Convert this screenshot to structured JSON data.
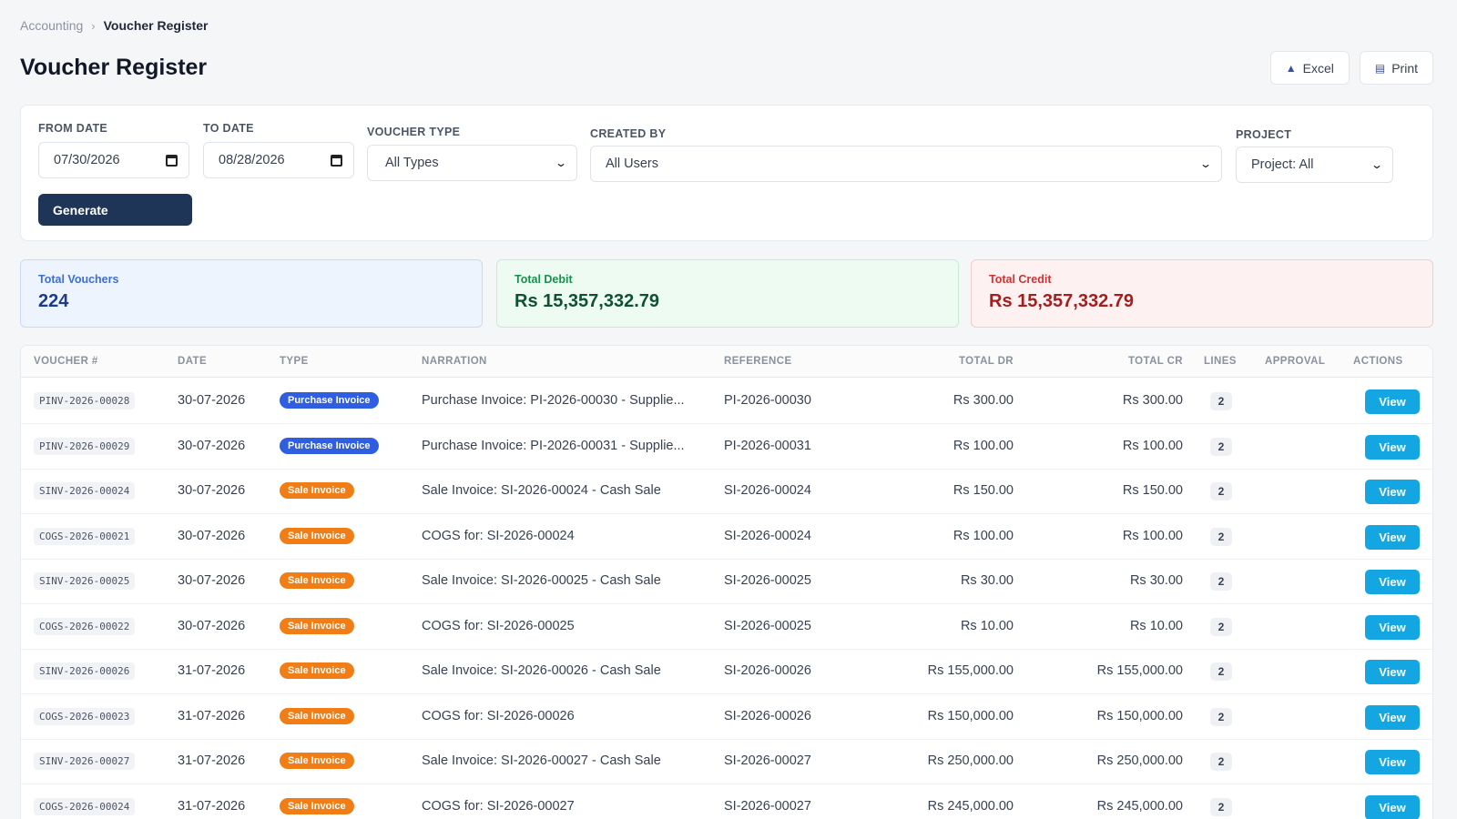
{
  "breadcrumb": {
    "parent": "Accounting",
    "separator": "›",
    "current": "Voucher Register"
  },
  "page_title": "Voucher Register",
  "actions": {
    "excel_label": "Excel",
    "print_label": "Print"
  },
  "filters": {
    "from_date_label": "FROM DATE",
    "from_date_value": "07/30/2026",
    "to_date_label": "TO DATE",
    "to_date_value": "08/28/2026",
    "voucher_type_label": "VOUCHER TYPE",
    "voucher_type_value": "All Types",
    "created_by_label": "CREATED BY",
    "created_by_value": "All Users",
    "project_label": "PROJECT",
    "project_value": "Project: All",
    "generate_label": "Generate"
  },
  "summary": {
    "total_vouchers_label": "Total Vouchers",
    "total_vouchers_value": "224",
    "total_debit_label": "Total Debit",
    "total_debit_value": "Rs 15,357,332.79",
    "total_credit_label": "Total Credit",
    "total_credit_value": "Rs 15,357,332.79"
  },
  "table": {
    "headers": [
      "VOUCHER #",
      "DATE",
      "TYPE",
      "NARRATION",
      "REFERENCE",
      "TOTAL DR",
      "TOTAL CR",
      "LINES",
      "APPROVAL",
      "ACTIONS"
    ],
    "rows": [
      {
        "voucher": "PINV-2026-00028",
        "date": "30-07-2026",
        "type": "Purchase Invoice",
        "narration": "Purchase Invoice: PI-2026-00030 - Supplie...",
        "reference": "PI-2026-00030",
        "dr": "Rs 300.00",
        "cr": "Rs 300.00",
        "lines": "2",
        "action": "View"
      },
      {
        "voucher": "PINV-2026-00029",
        "date": "30-07-2026",
        "type": "Purchase Invoice",
        "narration": "Purchase Invoice: PI-2026-00031 - Supplie...",
        "reference": "PI-2026-00031",
        "dr": "Rs 100.00",
        "cr": "Rs 100.00",
        "lines": "2",
        "action": "View"
      },
      {
        "voucher": "SINV-2026-00024",
        "date": "30-07-2026",
        "type": "Sale Invoice",
        "narration": "Sale Invoice: SI-2026-00024 - Cash Sale",
        "reference": "SI-2026-00024",
        "dr": "Rs 150.00",
        "cr": "Rs 150.00",
        "lines": "2",
        "action": "View"
      },
      {
        "voucher": "COGS-2026-00021",
        "date": "30-07-2026",
        "type": "Sale Invoice",
        "narration": "COGS for: SI-2026-00024",
        "reference": "SI-2026-00024",
        "dr": "Rs 100.00",
        "cr": "Rs 100.00",
        "lines": "2",
        "action": "View"
      },
      {
        "voucher": "SINV-2026-00025",
        "date": "30-07-2026",
        "type": "Sale Invoice",
        "narration": "Sale Invoice: SI-2026-00025 - Cash Sale",
        "reference": "SI-2026-00025",
        "dr": "Rs 30.00",
        "cr": "Rs 30.00",
        "lines": "2",
        "action": "View"
      },
      {
        "voucher": "COGS-2026-00022",
        "date": "30-07-2026",
        "type": "Sale Invoice",
        "narration": "COGS for: SI-2026-00025",
        "reference": "SI-2026-00025",
        "dr": "Rs 10.00",
        "cr": "Rs 10.00",
        "lines": "2",
        "action": "View"
      },
      {
        "voucher": "SINV-2026-00026",
        "date": "31-07-2026",
        "type": "Sale Invoice",
        "narration": "Sale Invoice: SI-2026-00026 - Cash Sale",
        "reference": "SI-2026-00026",
        "dr": "Rs 155,000.00",
        "cr": "Rs 155,000.00",
        "lines": "2",
        "action": "View"
      },
      {
        "voucher": "COGS-2026-00023",
        "date": "31-07-2026",
        "type": "Sale Invoice",
        "narration": "COGS for: SI-2026-00026",
        "reference": "SI-2026-00026",
        "dr": "Rs 150,000.00",
        "cr": "Rs 150,000.00",
        "lines": "2",
        "action": "View"
      },
      {
        "voucher": "SINV-2026-00027",
        "date": "31-07-2026",
        "type": "Sale Invoice",
        "narration": "Sale Invoice: SI-2026-00027 - Cash Sale",
        "reference": "SI-2026-00027",
        "dr": "Rs 250,000.00",
        "cr": "Rs 250,000.00",
        "lines": "2",
        "action": "View"
      },
      {
        "voucher": "COGS-2026-00024",
        "date": "31-07-2026",
        "type": "Sale Invoice",
        "narration": "COGS for: SI-2026-00027",
        "reference": "SI-2026-00027",
        "dr": "Rs 245,000.00",
        "cr": "Rs 245,000.00",
        "lines": "2",
        "action": "View"
      }
    ]
  },
  "colors": {
    "primary_dark": "#1e3557",
    "purchase_badge": "#2f5fe0",
    "sale_badge": "#f07d15",
    "view_button": "#14a6e3"
  }
}
